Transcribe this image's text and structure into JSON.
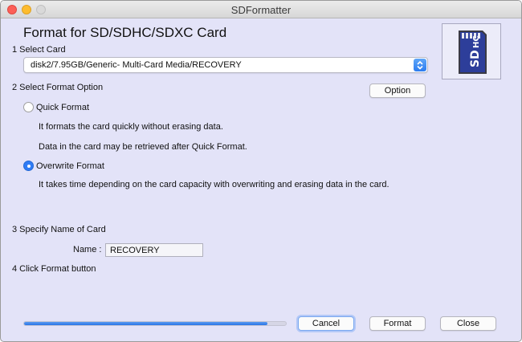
{
  "window": {
    "title": "SDFormatter"
  },
  "header": {
    "title": "Format for SD/SDHC/SDXC Card"
  },
  "logo": {
    "name": "sd-hc-card-icon",
    "text": "SD HC"
  },
  "section1": {
    "label": "1 Select Card",
    "selected_card": "disk2/7.95GB/Generic- Multi-Card Media/RECOVERY"
  },
  "section2": {
    "label": "2 Select Format Option",
    "option_button": "Option",
    "quick": {
      "label": "Quick Format",
      "checked": false,
      "desc1": "It formats the card quickly without erasing data.",
      "desc2": "Data in the card may be retrieved after Quick Format."
    },
    "overwrite": {
      "label": "Overwrite Format",
      "checked": true,
      "desc1": "It takes time depending on the card capacity with overwriting and erasing data in the card."
    }
  },
  "section3": {
    "label": "3 Specify Name of Card",
    "name_label": "Name :",
    "name_value": "RECOVERY"
  },
  "section4": {
    "label": "4 Click Format button"
  },
  "progress": {
    "fraction": 0.93
  },
  "buttons": {
    "cancel": "Cancel",
    "format": "Format",
    "close": "Close"
  },
  "colors": {
    "accent": "#2f7cf6",
    "window_bg": "#e3e3f8",
    "sd_card": "#2d3e9a"
  }
}
